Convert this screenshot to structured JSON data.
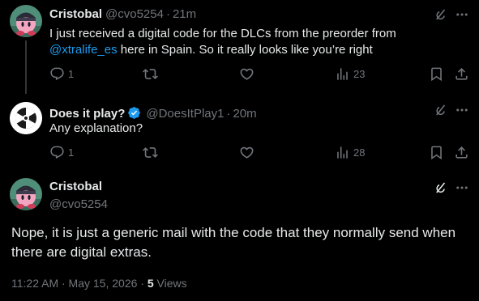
{
  "posts": [
    {
      "name": "Cristobal",
      "handle": "@cvo5254",
      "time": "21m",
      "text_before": "I just received a digital code for the DLCs from the preorder from",
      "mention": "@xtralife_es",
      "text_after": " here in Spain. So it really looks like you’re right",
      "replies": "1",
      "views": "23"
    },
    {
      "name": "Does it play?",
      "handle": "@DoesItPlay1",
      "time": "20m",
      "text": "Any explanation?",
      "replies": "1",
      "views": "28"
    }
  ],
  "main_post": {
    "name": "Cristobal",
    "handle": "@cvo5254",
    "text": "Nope, it is just a generic mail with the code that they normally send when there are digital extras.",
    "timestamp": "11:22 AM · May 15, 2026",
    "views_count": "5",
    "views_label": "Views"
  },
  "separator": "·",
  "icons": {
    "reply": "reply-icon",
    "repost": "repost-icon",
    "like": "like-icon",
    "views": "views-icon",
    "bookmark": "bookmark-icon",
    "share": "share-icon",
    "grok": "grok-icon",
    "more": "more-icon",
    "verified": "verified-badge-icon"
  },
  "colors": {
    "background": "#000000",
    "text": "#e7e9ea",
    "secondary": "#71767b",
    "link": "#1d9bf0",
    "verified": "#1d9bf0"
  }
}
